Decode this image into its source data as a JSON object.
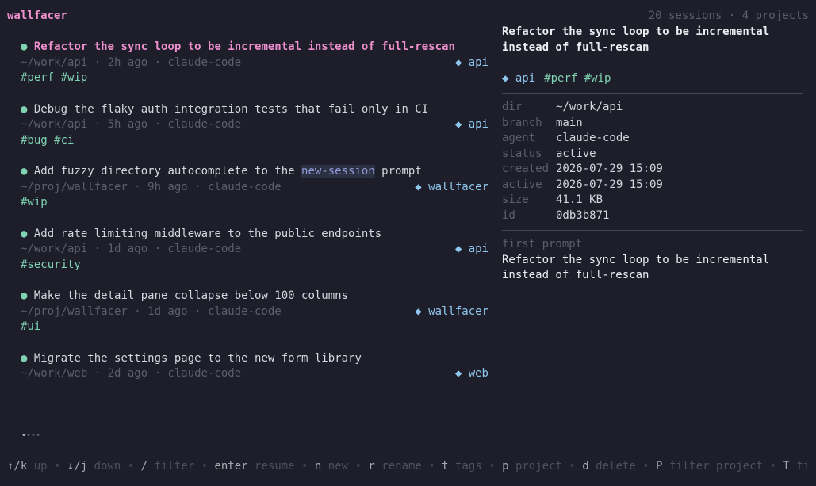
{
  "header": {
    "app_title": "wallfacer",
    "stats": "20 sessions · 4 projects"
  },
  "colors": {
    "background": "#1d1e29",
    "accent_pink": "#ee8fce",
    "tag_green": "#7fd3b2",
    "project_blue": "#8fc8ef",
    "muted": "#5d5e6c"
  },
  "sessions": [
    {
      "bullet": "●",
      "title": "Refactor the sync loop to be incremental instead of full-rescan",
      "meta": "~/work/api · 2h ago · claude-code",
      "project": "◆ api",
      "tags": "#perf #wip",
      "selected": true
    },
    {
      "bullet": "●",
      "title": "Debug the flaky auth integration tests that fail only in CI",
      "meta": "~/work/api · 5h ago · claude-code",
      "project": "◆ api",
      "tags": "#bug #ci"
    },
    {
      "bullet": "●",
      "title_pre": "Add fuzzy directory autocomplete to the ",
      "title_hl": "new-session",
      "title_post": " prompt",
      "meta": "~/proj/wallfacer · 9h ago · claude-code",
      "project": "◆ wallfacer",
      "tags": "#wip"
    },
    {
      "bullet": "●",
      "title": "Add rate limiting middleware to the public endpoints",
      "meta": "~/work/api · 1d ago · claude-code",
      "project": "◆ api",
      "tags": "#security"
    },
    {
      "bullet": "●",
      "title": "Make the detail pane collapse below 100 columns",
      "meta": "~/proj/wallfacer · 1d ago · claude-code",
      "project": "◆ wallfacer",
      "tags": "#ui"
    },
    {
      "bullet": "●",
      "title": "Migrate the settings page to the new form library",
      "meta": "~/work/web · 2d ago · claude-code",
      "project": "◆ web",
      "tags": ""
    }
  ],
  "scroll_dots": {
    "active": "•",
    "inactive": "•••"
  },
  "detail": {
    "title_line1": "Refactor the sync loop to be incremental",
    "title_line2": "instead of full-rescan",
    "project": "◆ api",
    "tags": "#perf #wip",
    "fields": [
      {
        "key": "dir",
        "value": "~/work/api"
      },
      {
        "key": "branch",
        "value": "main"
      },
      {
        "key": "agent",
        "value": "claude-code"
      },
      {
        "key": "status",
        "value": "active"
      },
      {
        "key": "created",
        "value": "2026-07-29 15:09"
      },
      {
        "key": "active",
        "value": "2026-07-29 15:09"
      },
      {
        "key": "size",
        "value": "41.1 KB"
      },
      {
        "key": "id",
        "value": "0db3b871"
      }
    ],
    "first_prompt_label": "first prompt",
    "first_prompt_line1": "Refactor the sync loop to be incremental",
    "first_prompt_line2": "instead of full-rescan"
  },
  "help": [
    {
      "key": "↑/k",
      "desc": "up"
    },
    {
      "key": "↓/j",
      "desc": "down"
    },
    {
      "key": "/",
      "desc": "filter"
    },
    {
      "key": "enter",
      "desc": "resume"
    },
    {
      "key": "n",
      "desc": "new"
    },
    {
      "key": "r",
      "desc": "rename"
    },
    {
      "key": "t",
      "desc": "tags"
    },
    {
      "key": "p",
      "desc": "project"
    },
    {
      "key": "d",
      "desc": "delete"
    },
    {
      "key": "P",
      "desc": "filter project"
    },
    {
      "key": "T",
      "desc": "fi"
    }
  ]
}
